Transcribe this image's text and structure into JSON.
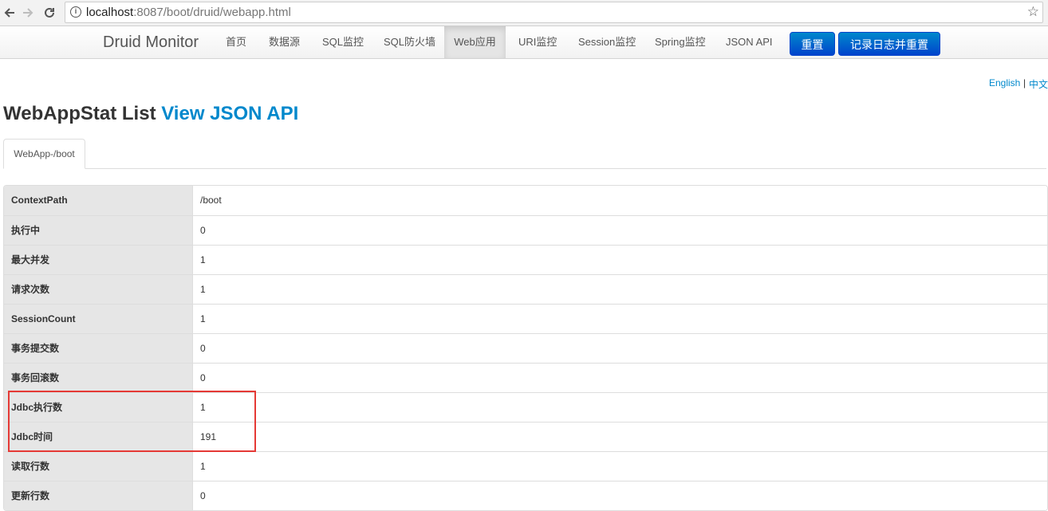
{
  "browser": {
    "url_host": "localhost",
    "url_rest": ":8087/boot/druid/webapp.html"
  },
  "navbar": {
    "brand": "Druid Monitor",
    "items": [
      {
        "label": "首页"
      },
      {
        "label": "数据源"
      },
      {
        "label": "SQL监控"
      },
      {
        "label": "SQL防火墙"
      },
      {
        "label": "Web应用"
      },
      {
        "label": "URI监控"
      },
      {
        "label": "Session监控"
      },
      {
        "label": "Spring监控"
      },
      {
        "label": "JSON API"
      }
    ],
    "active_item": "Web应用",
    "reset_label": "重置",
    "log_reset_label": "记录日志并重置"
  },
  "lang": {
    "english": "English",
    "separator": "|",
    "chinese": "中文"
  },
  "page": {
    "title": "WebAppStat List",
    "api_link": "View JSON API"
  },
  "tabs": [
    {
      "label": "WebApp-/boot"
    }
  ],
  "table": {
    "rows": [
      {
        "key": "ContextPath",
        "value": "/boot"
      },
      {
        "key": "执行中",
        "value": "0"
      },
      {
        "key": "最大并发",
        "value": "1"
      },
      {
        "key": "请求次数",
        "value": "1"
      },
      {
        "key": "SessionCount",
        "value": "1"
      },
      {
        "key": "事务提交数",
        "value": "0"
      },
      {
        "key": "事务回滚数",
        "value": "0"
      },
      {
        "key": "Jdbc执行数",
        "value": "1"
      },
      {
        "key": "Jdbc时间",
        "value": "191"
      },
      {
        "key": "读取行数",
        "value": "1"
      },
      {
        "key": "更新行数",
        "value": "0"
      }
    ]
  },
  "colors": {
    "link": "#0088cc",
    "primary_button": "#0055cc",
    "highlight_box": "#e53935"
  }
}
